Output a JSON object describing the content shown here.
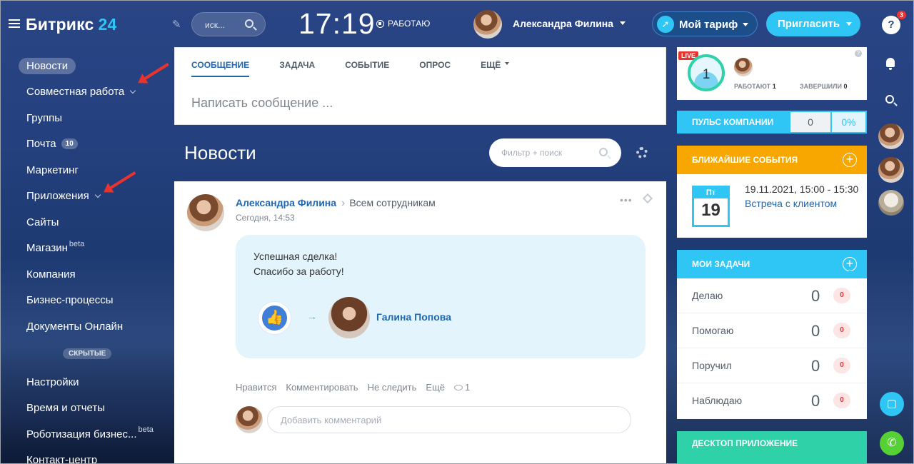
{
  "header": {
    "logo_name": "Битрикс",
    "logo_num": "24",
    "search_placeholder": "иск...",
    "clock": "17:19",
    "work_status": "РАБОТАЮ",
    "user_name": "Александра Филина",
    "tariff_label": "Мой тариф",
    "invite_label": "Пригласить"
  },
  "sidebar": {
    "items": [
      {
        "label": "Новости"
      },
      {
        "label": "Совместная работа"
      },
      {
        "label": "Группы"
      },
      {
        "label": "Почта",
        "badge": "10"
      },
      {
        "label": "Маркетинг"
      },
      {
        "label": "Приложения"
      },
      {
        "label": "Сайты"
      },
      {
        "label": "Магазин",
        "sup": "beta"
      },
      {
        "label": "Компания"
      },
      {
        "label": "Бизнес-процессы"
      },
      {
        "label": "Документы Онлайн"
      }
    ],
    "hidden_label": "СКРЫТЫЕ",
    "hidden_items": [
      {
        "label": "Настройки"
      },
      {
        "label": "Время и отчеты"
      },
      {
        "label": "Роботизация бизнес...",
        "sup": "beta"
      },
      {
        "label": "Контакт-центр"
      }
    ]
  },
  "composer": {
    "tabs": [
      "СООБЩЕНИЕ",
      "ЗАДАЧА",
      "СОБЫТИЕ",
      "ОПРОС",
      "ЕЩЁ"
    ],
    "placeholder": "Написать сообщение ..."
  },
  "feed": {
    "title": "Новости",
    "filter_placeholder": "Фильтр + поиск"
  },
  "post": {
    "author": "Александра Филина",
    "recipients": "Всем сотрудникам",
    "date": "Сегодня, 14:53",
    "text_line1": "Успешная сделка!",
    "text_line2": "Спасибо за работу!",
    "recipient_name": "Галина Попова",
    "actions": [
      "Нравится",
      "Комментировать",
      "Не следить",
      "Ещё"
    ],
    "views": "1",
    "comment_placeholder": "Добавить комментарий"
  },
  "live": {
    "tag": "LIVE",
    "count": "1",
    "working_label": "РАБОТАЮТ",
    "working_count": "1",
    "finished_label": "ЗАВЕРШИЛИ",
    "finished_count": "0"
  },
  "pulse": {
    "label": "ПУЛЬС КОМПАНИИ",
    "value": "0",
    "percent": "0%"
  },
  "events": {
    "label": "БЛИЖАЙШИЕ СОБЫТИЯ",
    "weekday": "Пт",
    "day": "19",
    "datetime": "19.11.2021, 15:00 - 15:30",
    "title": "Встреча с клиентом"
  },
  "tasks": {
    "label": "МОИ ЗАДАЧИ",
    "rows": [
      {
        "label": "Делаю",
        "count": "0",
        "badge": "0"
      },
      {
        "label": "Помогаю",
        "count": "0",
        "badge": "0"
      },
      {
        "label": "Поручил",
        "count": "0",
        "badge": "0"
      },
      {
        "label": "Наблюдаю",
        "count": "0",
        "badge": "0"
      }
    ]
  },
  "desktop": {
    "label": "ДЕСКТОП ПРИЛОЖЕНИЕ"
  },
  "rightbar": {
    "help_badge": "3",
    "help_symbol": "?"
  },
  "colors": {
    "accent": "#2fc6f6",
    "link": "#2067b0",
    "events": "#f7a700",
    "desktop": "#2fd1a9",
    "alert": "#e8332e"
  }
}
